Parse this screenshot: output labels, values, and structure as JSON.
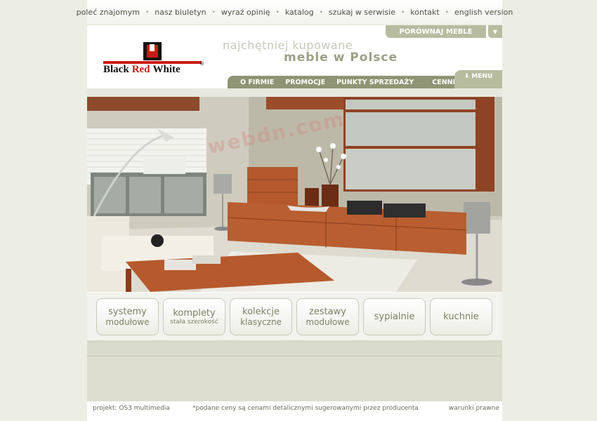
{
  "top_nav": [
    "poleć znajomym",
    "nasz biuletyn",
    "wyraź opinię",
    "katalog",
    "szukaj w serwisie",
    "kontakt",
    "english version"
  ],
  "top_nav_separator": "•",
  "compare": {
    "label": "PORÓWNAJ MEBLE",
    "arrow": "▼"
  },
  "logo": {
    "word1": "Black",
    "word2": "Red",
    "word3": "White",
    "reg": "®"
  },
  "slogan": {
    "line1": "najchętniej kupowane",
    "line2": "meble w Polsce"
  },
  "main_menu": [
    "O FIRMIE",
    "PROMOCJE",
    "PUNKTY SPRZEDAŻY",
    "CENNI"
  ],
  "menu_tab": "⬇ MENU",
  "watermark": "webdn.com",
  "categories": [
    {
      "line1": "systemy",
      "line2": "modułowe"
    },
    {
      "line1": "komplety",
      "sub": "stała szerokość"
    },
    {
      "line1": "kolekcje",
      "line2": "klasyczne"
    },
    {
      "line1": "zestawy",
      "line2": "modułowe"
    },
    {
      "line1": "sypialnie"
    },
    {
      "line1": "kuchnie"
    }
  ],
  "footer": {
    "credit": "projekt: OS3 multimedia",
    "note": "*podane ceny są cenami detalicznymi sugerowanymi przez producenta",
    "terms": "warunki prawne"
  },
  "colors": {
    "menu_bar": "#8f9474",
    "tab": "#b8bc9f",
    "brand_red": "#cc1a14",
    "wood": "#b5582c"
  }
}
